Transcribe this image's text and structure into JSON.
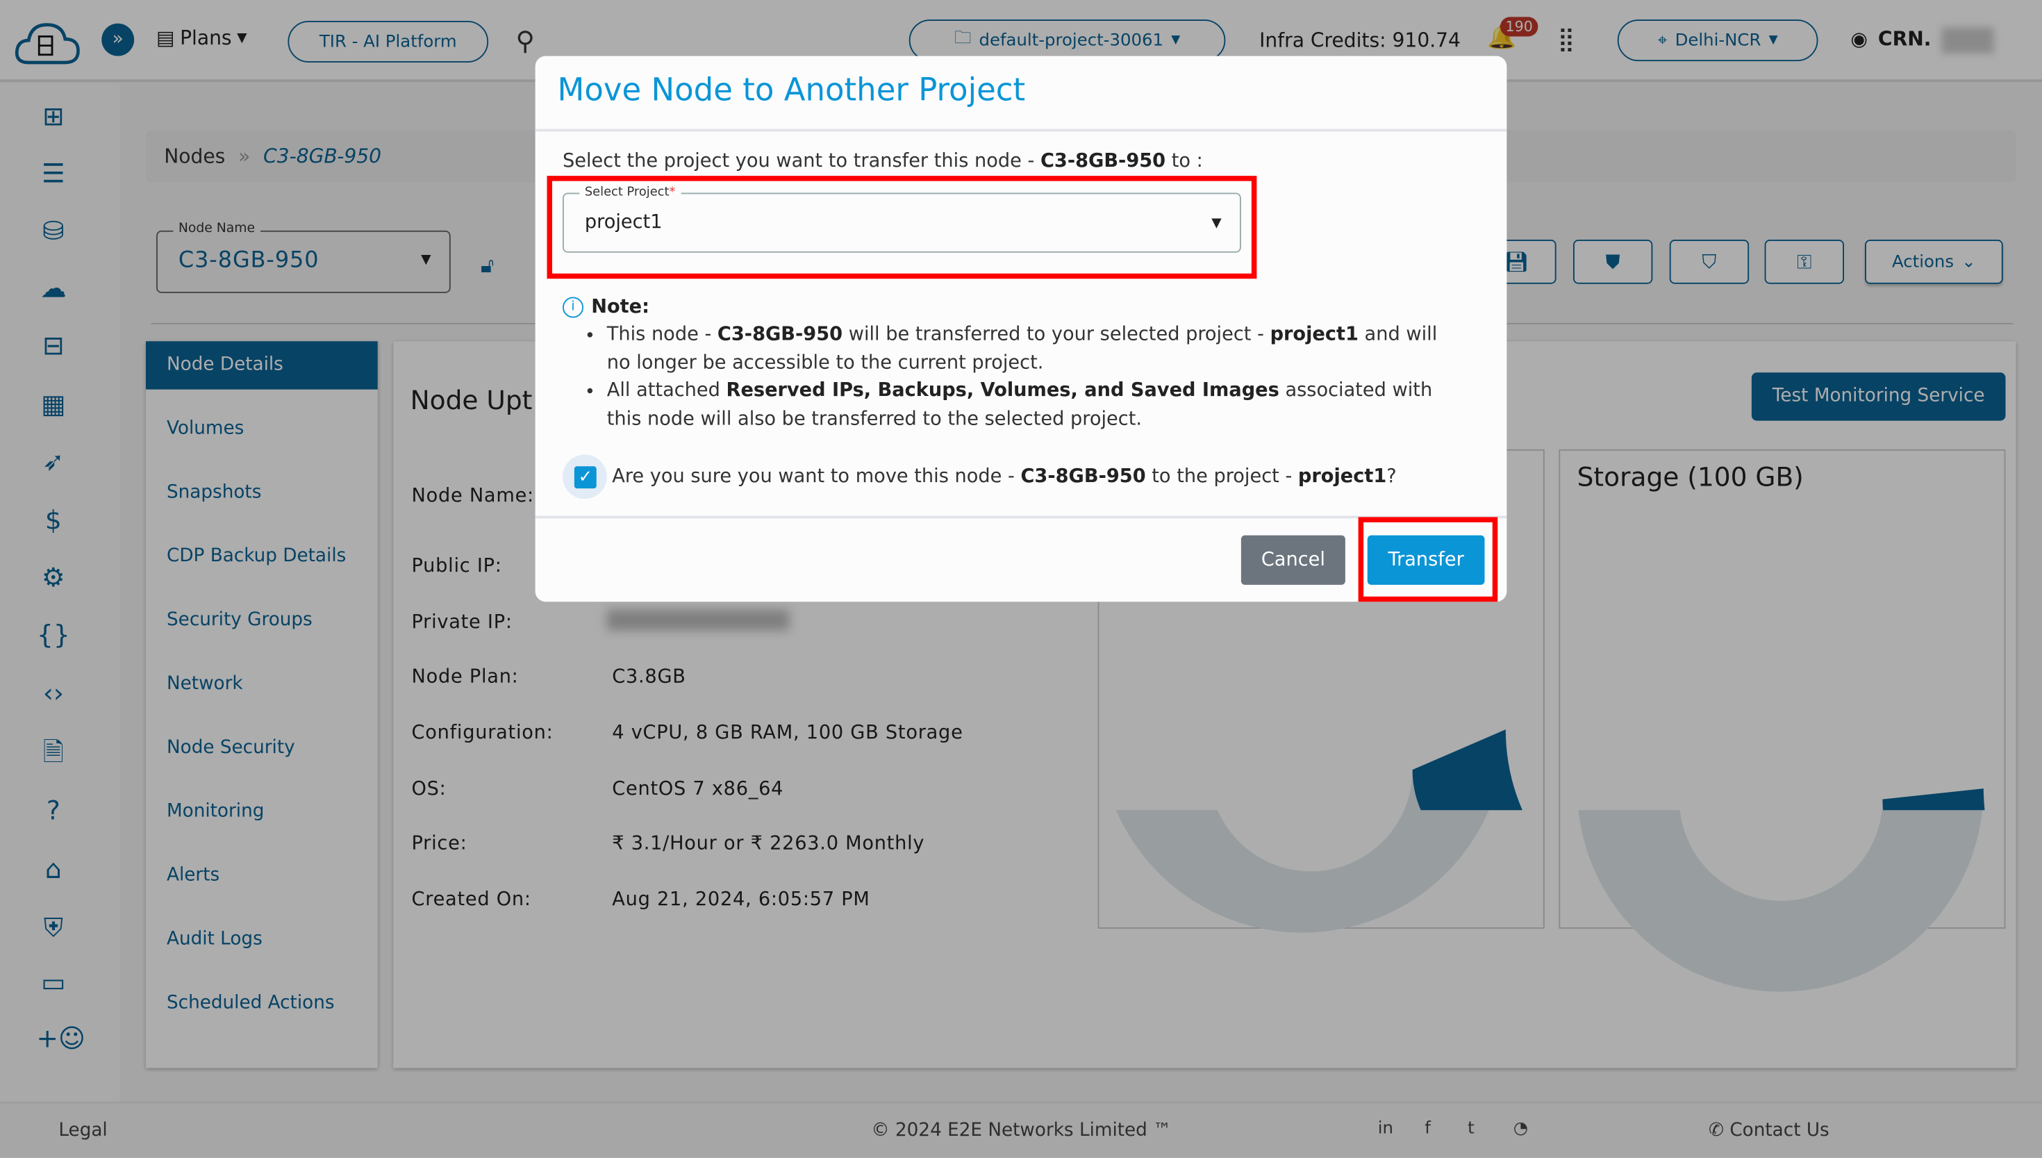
{
  "topbar": {
    "logo_text": "E2E Cloud",
    "plans": "Plans",
    "tir": "TIR - AI Platform",
    "project": "default-project-30061",
    "credits": "Infra Credits: 910.74",
    "notifications": "190",
    "region": "Delhi-NCR",
    "crn": "CRN."
  },
  "breadcrumb": {
    "root": "Nodes",
    "separator": "»",
    "current": "C3-8GB-950"
  },
  "node_select": {
    "label": "Node Name",
    "value": "C3-8GB-950"
  },
  "toolbar": {
    "actions": "Actions"
  },
  "nav": [
    "Node Details",
    "Volumes",
    "Snapshots",
    "CDP Backup Details",
    "Security Groups",
    "Network",
    "Node Security",
    "Monitoring",
    "Alerts",
    "Audit Logs",
    "Scheduled Actions"
  ],
  "main": {
    "title": "Node Upt",
    "test_button": "Test Monitoring Service",
    "rows": [
      {
        "label": "Node Name:",
        "value": ""
      },
      {
        "label": "Public IP:",
        "value": ""
      },
      {
        "label": "Private IP:",
        "value": ""
      },
      {
        "label": "Node Plan:",
        "value": "C3.8GB"
      },
      {
        "label": "Configuration:",
        "value": "4 vCPU, 8 GB RAM, 100 GB Storage"
      },
      {
        "label": "OS:",
        "value": "CentOS 7 x86_64"
      },
      {
        "label": "Price:",
        "value": "₹ 3.1/Hour or  ₹ 2263.0 Monthly"
      },
      {
        "label": "Created On:",
        "value": "Aug 21, 2024, 6:05:57 PM"
      }
    ],
    "gauges": [
      {
        "title": "",
        "fraction": 0.13
      },
      {
        "title": "Storage (100 GB)",
        "fraction": 0.034
      }
    ],
    "gauge_colors": {
      "track": "#e0e8ec",
      "fill": "#0b6396"
    }
  },
  "modal": {
    "title": "Move Node to Another Project",
    "intro": "Select the project you want to transfer this node - ",
    "node": "C3-8GB-950",
    "intro_end": " to :",
    "select_label": "Select Project",
    "required": "*",
    "select_value": "project1",
    "note_title": "Note:",
    "note1_a": "This node - ",
    "note1_node": "C3-8GB-950",
    "note1_b": " will be transferred to your selected project - ",
    "note1_project": "project1",
    "note1_c": " and will no longer be accessible to the current project.",
    "note2_a": "All attached ",
    "note2_bold": "Reserved IPs, Backups, Volumes, and Saved Images",
    "note2_b": " associated with this node will also be transferred to the selected project.",
    "confirm_a": "Are you sure you want to move this node - ",
    "confirm_node": "C3-8GB-950",
    "confirm_b": " to the project - ",
    "confirm_project": "project1",
    "confirm_c": "?",
    "confirm_checked": true,
    "cancel": "Cancel",
    "transfer": "Transfer"
  },
  "footer": {
    "legal": "Legal",
    "copyright": "© 2024 E2E Networks Limited ™",
    "contact": "Contact Us"
  },
  "colors": {
    "brand": "#0b6396",
    "accent": "#0a95d6",
    "highlight": "#ff0000"
  }
}
